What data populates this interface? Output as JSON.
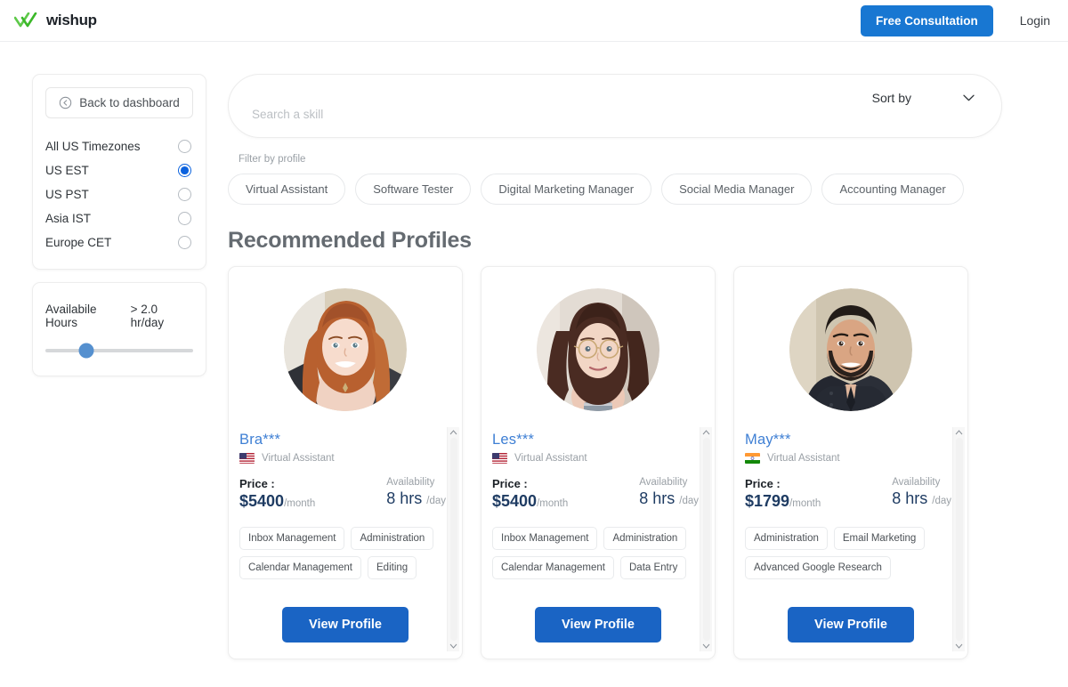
{
  "header": {
    "logo_text": "wishup",
    "logo_icon": "double-check-icon",
    "cta_label": "Free Consultation",
    "login_label": "Login",
    "cta_color": "#1877d2"
  },
  "sidebar": {
    "back_button": {
      "label": "Back to dashboard",
      "icon": "arrow-left-circle-icon"
    },
    "timezones": [
      {
        "label": "All US Timezones",
        "selected": false
      },
      {
        "label": "US EST",
        "selected": true
      },
      {
        "label": "US PST",
        "selected": false
      },
      {
        "label": "Asia IST",
        "selected": false
      },
      {
        "label": "Europe CET",
        "selected": false
      }
    ],
    "hours": {
      "label": "Availabile Hours",
      "value": "> 2.0 hr/day",
      "slider_percent": 28
    },
    "accent_color": "#0b62de"
  },
  "search": {
    "placeholder": "Search a skill",
    "value": "",
    "sort_label": "Sort by",
    "sort_icon": "chevron-down-icon"
  },
  "filters": {
    "label": "Filter by profile",
    "pills": [
      "Virtual Assistant",
      "Software Tester",
      "Digital Marketing Manager",
      "Social Media Manager",
      "Accounting Manager"
    ]
  },
  "main": {
    "section_title": "Recommended Profiles"
  },
  "cards": [
    {
      "name": "Bra***",
      "flag": "us",
      "role": "Virtual Assistant",
      "price_label": "Price :",
      "price_value": "$5400",
      "price_unit": "/month",
      "avail_label": "Availability",
      "avail_value": "8 hrs",
      "avail_unit": "/day",
      "skills": [
        "Inbox Management",
        "Administration",
        "Calendar Management",
        "Editing"
      ],
      "button_label": "View Profile",
      "avatar": "woman-red-hair"
    },
    {
      "name": "Les***",
      "flag": "us",
      "role": "Virtual Assistant",
      "price_label": "Price :",
      "price_value": "$5400",
      "price_unit": "/month",
      "avail_label": "Availability",
      "avail_value": "8 hrs",
      "avail_unit": "/day",
      "skills": [
        "Inbox Management",
        "Administration",
        "Calendar Management",
        "Data Entry"
      ],
      "button_label": "View Profile",
      "avatar": "woman-glasses"
    },
    {
      "name": "May***",
      "flag": "in",
      "role": "Virtual Assistant",
      "price_label": "Price :",
      "price_value": "$1799",
      "price_unit": "/month",
      "avail_label": "Availability",
      "avail_value": "8 hrs",
      "avail_unit": "/day",
      "skills": [
        "Administration",
        "Email Marketing",
        "Advanced Google Research"
      ],
      "button_label": "View Profile",
      "avatar": "man-beard"
    }
  ]
}
